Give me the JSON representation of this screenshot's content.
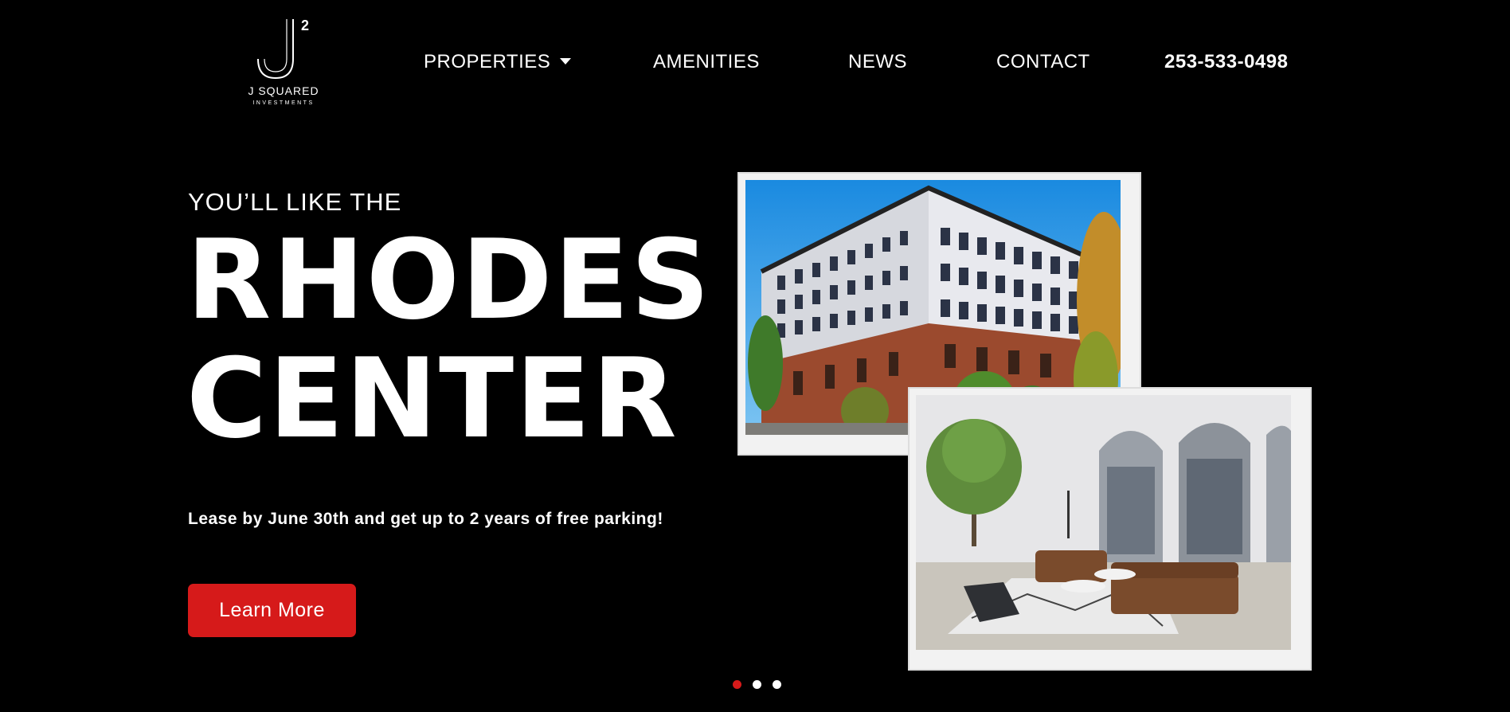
{
  "logo": {
    "mark": "J",
    "superscript": "2",
    "name": "J SQUARED",
    "tagline": "INVESTMENTS"
  },
  "nav": {
    "items": [
      "PROPERTIES",
      "AMENITIES",
      "NEWS",
      "CONTACT"
    ],
    "phone": "253-533-0498"
  },
  "hero": {
    "eyebrow": "YOU’LL LIKE THE",
    "title_line1": "RHODES",
    "title_line2": "CENTER",
    "promo": "Lease by June 30th and get up to 2 years of free parking!",
    "cta": "Learn More"
  },
  "slider": {
    "count": 3,
    "active_index": 0
  },
  "colors": {
    "background": "#000000",
    "accent": "#d61a1a",
    "text": "#ffffff"
  },
  "icons": {
    "properties_dropdown": "caret-down-icon"
  }
}
